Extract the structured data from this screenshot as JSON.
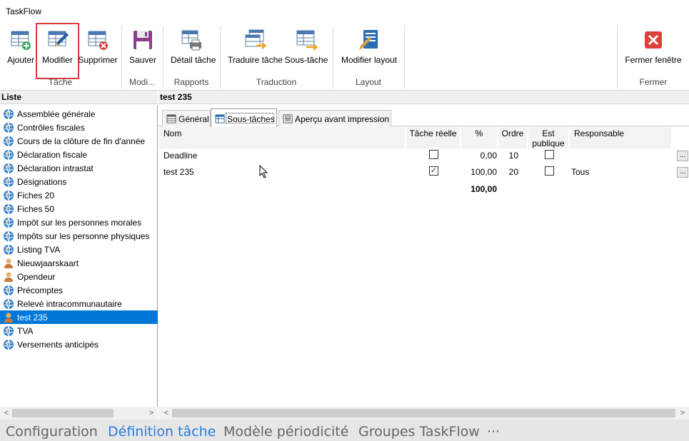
{
  "window": {
    "title": "TaskFlow"
  },
  "ribbon": {
    "groups": [
      {
        "label": "Tâche",
        "buttons": [
          {
            "label": "Ajouter",
            "icon": "add-grid-icon"
          },
          {
            "label": "Modifier",
            "icon": "edit-grid-icon",
            "selected": true
          },
          {
            "label": "Supprimer",
            "icon": "delete-grid-icon"
          }
        ]
      },
      {
        "label": "Modi...",
        "buttons": [
          {
            "label": "Sauver",
            "icon": "save-icon"
          }
        ]
      },
      {
        "label": "Rapports",
        "buttons": [
          {
            "label": "Détail tâche",
            "icon": "print-icon"
          }
        ]
      },
      {
        "label": "Traduction",
        "buttons": [
          {
            "label": "Traduire tâche",
            "icon": "translate-icon"
          },
          {
            "label": "Sous-tâche",
            "icon": "subtask-icon"
          }
        ]
      },
      {
        "label": "Layout",
        "buttons": [
          {
            "label": "Modifier layout",
            "icon": "layout-icon"
          }
        ]
      },
      {
        "label": "Fermer",
        "buttons": [
          {
            "label": "Fermer fenêtre",
            "icon": "close-window-icon"
          }
        ]
      }
    ]
  },
  "list": {
    "header": "Liste",
    "items": [
      {
        "label": "Assemblée générale",
        "icon": "globe-user-icon"
      },
      {
        "label": "Contrôles fiscales",
        "icon": "globe-user-icon"
      },
      {
        "label": "Cours de la clôture de fin d'année",
        "icon": "globe-user-icon"
      },
      {
        "label": "Déclaration fiscale",
        "icon": "globe-user-icon"
      },
      {
        "label": "Déclaration intrastat",
        "icon": "globe-user-icon"
      },
      {
        "label": "Désignations",
        "icon": "globe-user-icon"
      },
      {
        "label": "Fiches 20",
        "icon": "globe-user-icon"
      },
      {
        "label": "Fiches 50",
        "icon": "globe-user-icon"
      },
      {
        "label": "Impôt sur les personnes morales",
        "icon": "globe-user-icon"
      },
      {
        "label": "Impôts sur les personne physiques",
        "icon": "globe-user-icon"
      },
      {
        "label": "Listing TVA",
        "icon": "globe-user-icon"
      },
      {
        "label": "Nieuwjaarskaart",
        "icon": "user-icon"
      },
      {
        "label": "Opendeur",
        "icon": "user-icon"
      },
      {
        "label": "Précomptes",
        "icon": "globe-user-icon"
      },
      {
        "label": "Relevé intracommunautaire",
        "icon": "globe-user-icon"
      },
      {
        "label": "test 235",
        "icon": "user-icon",
        "selected": true
      },
      {
        "label": "TVA",
        "icon": "globe-user-icon"
      },
      {
        "label": "Versements anticipés",
        "icon": "globe-user-icon"
      }
    ]
  },
  "detail": {
    "header": "test 235",
    "tabs": [
      {
        "label": "Général",
        "icon": "general-tab-icon"
      },
      {
        "label": "Sous-tâches",
        "icon": "subtasks-tab-icon",
        "active": true
      },
      {
        "label": "Aperçu avant impression",
        "icon": "preview-tab-icon"
      }
    ],
    "columns": {
      "nom": "Nom",
      "reelle": "Tâche réelle",
      "pct": "%",
      "ordre": "Ordre",
      "publique_1": "Est",
      "publique_2": "publique",
      "responsable": "Responsable"
    },
    "rows": [
      {
        "nom": "Deadline",
        "reelle": false,
        "pct": "0,00",
        "ordre": "10",
        "publique": false,
        "responsable": ""
      },
      {
        "nom": "test 235",
        "reelle": true,
        "pct": "100,00",
        "ordre": "20",
        "publique": false,
        "responsable": "Tous"
      }
    ],
    "total_pct": "100,00",
    "ellipsis": "..."
  },
  "scroll": {
    "left_arrow": "<",
    "right_arrow": ">"
  },
  "bottom_nav": [
    {
      "label": "Configuration"
    },
    {
      "label": "Définition tâche",
      "active": true
    },
    {
      "label": "Modèle périodicité"
    },
    {
      "label": "Groupes TaskFlow"
    },
    {
      "label": "···"
    }
  ],
  "colors": {
    "accent": "#0078d7",
    "highlight_border": "#d93a3a",
    "nav_active": "#2b7bd8"
  }
}
